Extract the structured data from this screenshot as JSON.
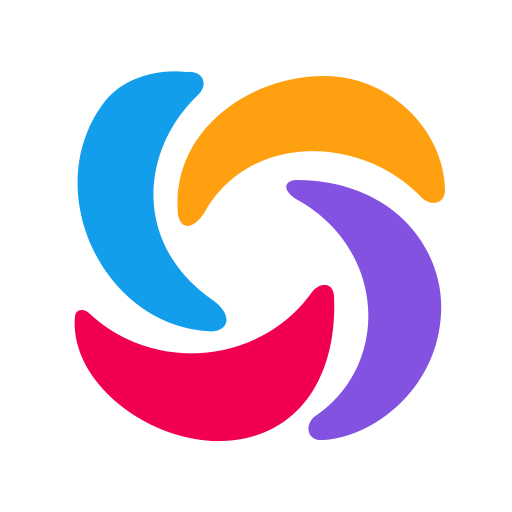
{
  "logo": {
    "name": "pinwheel-logo",
    "colors": {
      "blue": "#139EEC",
      "orange": "#FFA011",
      "purple": "#8452E0",
      "red": "#F1004F"
    }
  }
}
